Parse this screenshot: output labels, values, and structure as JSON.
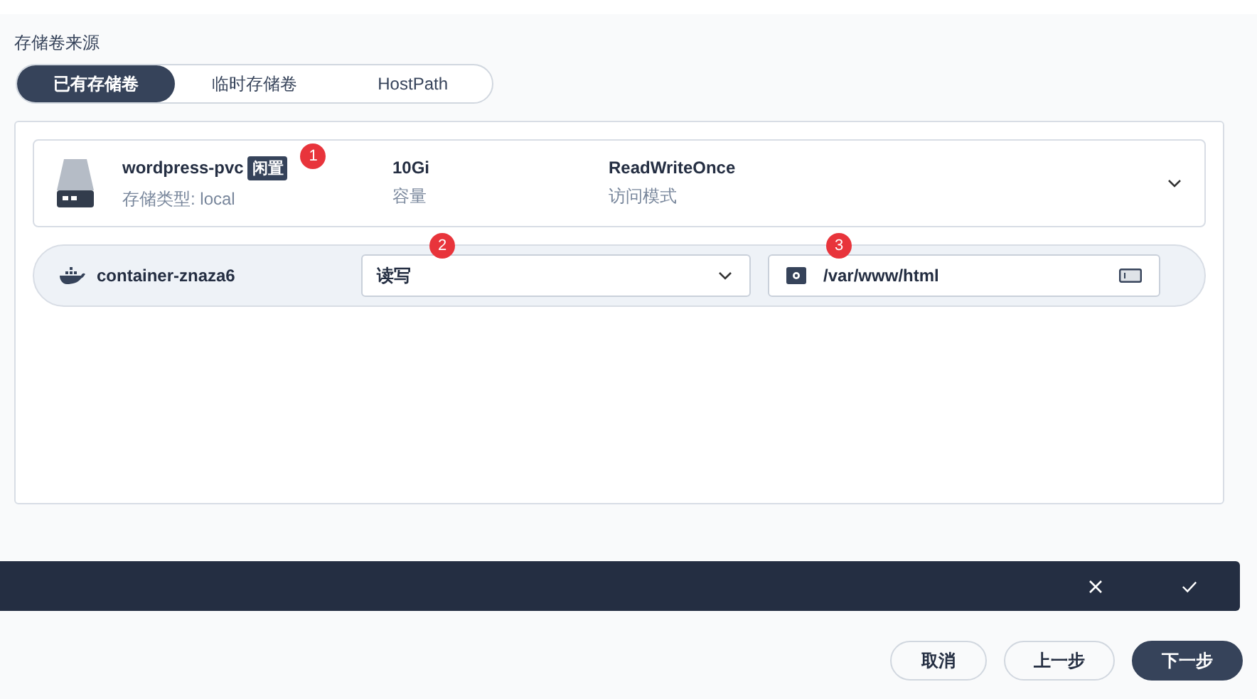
{
  "source_label": "存储卷来源",
  "tabs": [
    {
      "label": "已有存储卷",
      "selected": true
    },
    {
      "label": "临时存储卷",
      "selected": false
    },
    {
      "label": "HostPath",
      "selected": false
    }
  ],
  "volume": {
    "name": "wordpress-pvc",
    "tag": "闲置",
    "badge": "1",
    "type": "存储类型: local",
    "capacity": "10Gi",
    "capacity_label": "容量",
    "access_mode": "ReadWriteOnce",
    "access_label": "访问模式"
  },
  "mount": {
    "container": "container-znaza6",
    "mode": "读写",
    "mode_badge": "2",
    "path": "/var/www/html",
    "path_badge": "3"
  },
  "footer": {
    "buttons": [
      {
        "label": "取消",
        "kind": "plain"
      },
      {
        "label": "上一步",
        "kind": "plain"
      },
      {
        "label": "下一步",
        "kind": "primary"
      }
    ]
  }
}
